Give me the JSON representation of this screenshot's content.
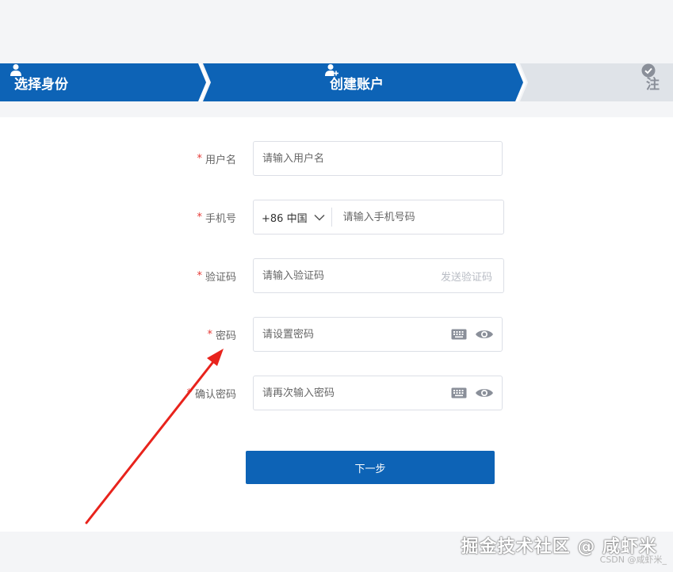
{
  "stepper": {
    "steps": [
      {
        "label": "选择身份",
        "state": "done",
        "icon": "user-icon"
      },
      {
        "label": "创建账户",
        "state": "active",
        "icon": "user-plus-icon"
      },
      {
        "label": "注",
        "state": "pending",
        "icon": "check-circle-icon"
      }
    ]
  },
  "form": {
    "username": {
      "label": "用户名",
      "placeholder": "请输入用户名"
    },
    "phone": {
      "label": "手机号",
      "country": "+86 中国",
      "placeholder": "请输入手机号码"
    },
    "code": {
      "label": "验证码",
      "placeholder": "请输入验证码",
      "send_label": "发送验证码"
    },
    "password": {
      "label": "密码",
      "placeholder": "请设置密码"
    },
    "confirm": {
      "label": "确认密码",
      "placeholder": "请再次输入密码"
    },
    "required_mark": "*",
    "next_label": "下一步"
  },
  "watermark": {
    "large": "掘金技术社区 @ 咸虾米",
    "small": "CSDN @咸虾米_"
  },
  "colors": {
    "primary": "#0d63b6",
    "required": "#e53935",
    "annotation": "#e8231c",
    "step_pending": "#dfe3e8"
  }
}
